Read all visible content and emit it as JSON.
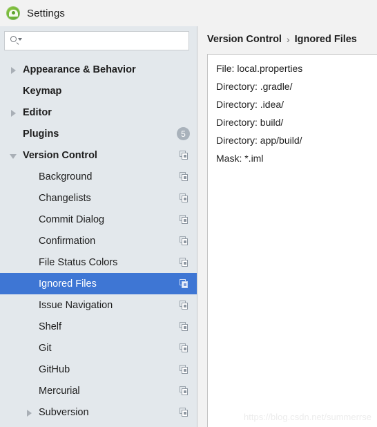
{
  "window": {
    "title": "Settings",
    "app_icon": "android-studio-icon"
  },
  "search": {
    "value": "",
    "placeholder": "",
    "icon": "search-icon",
    "dropdown_icon": "chevron-down-icon"
  },
  "colors": {
    "selection_blue": "#3e76d4",
    "sidebar_bg": "#e3e8ec",
    "panel_bg": "#f2f2f2",
    "content_bg": "#ffffff",
    "badge_grey": "#a9b2bb"
  },
  "sidebar": {
    "items": [
      {
        "label": "Appearance & Behavior",
        "level": 0,
        "arrow": "collapsed",
        "selected": false,
        "copy_icon": false,
        "badge": null
      },
      {
        "label": "Keymap",
        "level": 0,
        "arrow": "none",
        "selected": false,
        "copy_icon": false,
        "badge": null
      },
      {
        "label": "Editor",
        "level": 0,
        "arrow": "collapsed",
        "selected": false,
        "copy_icon": false,
        "badge": null
      },
      {
        "label": "Plugins",
        "level": 0,
        "arrow": "none",
        "selected": false,
        "copy_icon": false,
        "badge": "5"
      },
      {
        "label": "Version Control",
        "level": 0,
        "arrow": "expanded",
        "selected": false,
        "copy_icon": true,
        "badge": null
      },
      {
        "label": "Background",
        "level": 1,
        "arrow": "none",
        "selected": false,
        "copy_icon": true,
        "badge": null
      },
      {
        "label": "Changelists",
        "level": 1,
        "arrow": "none",
        "selected": false,
        "copy_icon": true,
        "badge": null
      },
      {
        "label": "Commit Dialog",
        "level": 1,
        "arrow": "none",
        "selected": false,
        "copy_icon": true,
        "badge": null
      },
      {
        "label": "Confirmation",
        "level": 1,
        "arrow": "none",
        "selected": false,
        "copy_icon": true,
        "badge": null
      },
      {
        "label": "File Status Colors",
        "level": 1,
        "arrow": "none",
        "selected": false,
        "copy_icon": true,
        "badge": null
      },
      {
        "label": "Ignored Files",
        "level": 1,
        "arrow": "none",
        "selected": true,
        "copy_icon": true,
        "badge": null
      },
      {
        "label": "Issue Navigation",
        "level": 1,
        "arrow": "none",
        "selected": false,
        "copy_icon": true,
        "badge": null
      },
      {
        "label": "Shelf",
        "level": 1,
        "arrow": "none",
        "selected": false,
        "copy_icon": true,
        "badge": null
      },
      {
        "label": "Git",
        "level": 1,
        "arrow": "none",
        "selected": false,
        "copy_icon": true,
        "badge": null
      },
      {
        "label": "GitHub",
        "level": 1,
        "arrow": "none",
        "selected": false,
        "copy_icon": true,
        "badge": null
      },
      {
        "label": "Mercurial",
        "level": 1,
        "arrow": "none",
        "selected": false,
        "copy_icon": true,
        "badge": null
      },
      {
        "label": "Subversion",
        "level": 1,
        "arrow": "collapsed",
        "selected": false,
        "copy_icon": true,
        "badge": null
      }
    ]
  },
  "main": {
    "breadcrumb": {
      "parent": "Version Control",
      "separator": "›",
      "current": "Ignored Files"
    },
    "ignored_list": [
      "File: local.properties",
      "Directory: .gradle/",
      "Directory: .idea/",
      "Directory: build/",
      "Directory: app/build/",
      "Mask: *.iml"
    ]
  },
  "watermark": {
    "text": "https://blog.csdn.net/summerrse"
  }
}
